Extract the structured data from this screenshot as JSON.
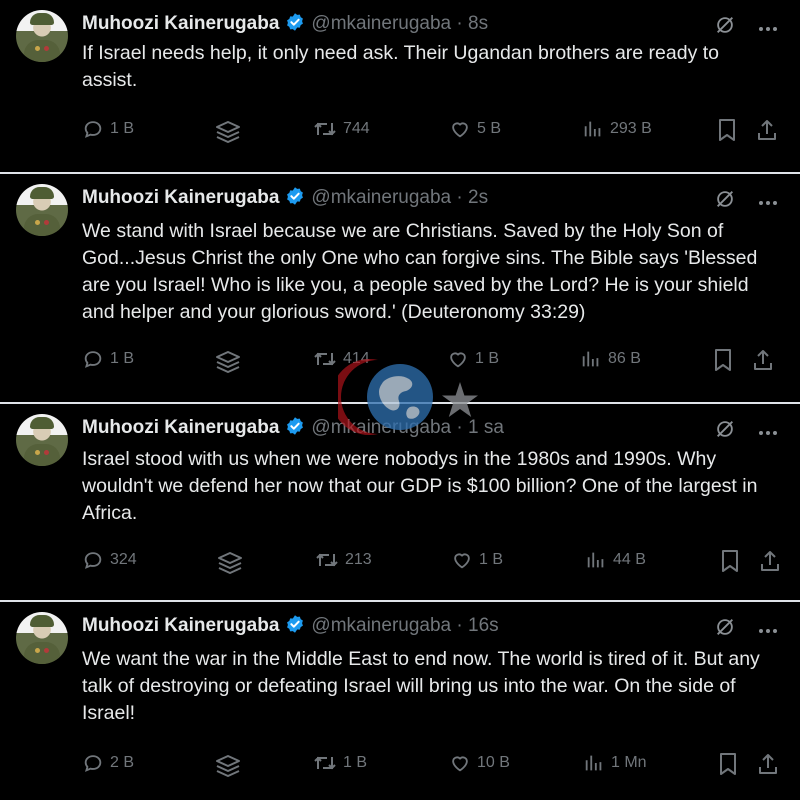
{
  "tweets": [
    {
      "name": "Muhoozi Kainerugaba",
      "handle": "@mkainerugaba",
      "dot": "·",
      "time": "8s",
      "text": "If Israel needs help, it only need ask. Their Ugandan brothers are ready to assist.",
      "replies": "1 B",
      "retweets": "744",
      "likes": "5 B",
      "views": "293 B"
    },
    {
      "name": "Muhoozi Kainerugaba",
      "handle": "@mkainerugaba",
      "dot": "·",
      "time": "2s",
      "text": "We stand with Israel because we are Christians. Saved by the Holy Son of God...Jesus Christ the only One who can forgive sins. The Bible says 'Blessed are you Israel! Who is like you, a people saved by the Lord? He is your shield and helper and your glorious sword.' (Deuteronomy 33:29)",
      "replies": "1 B",
      "retweets": "414",
      "likes": "1 B",
      "views": "86 B"
    },
    {
      "name": "Muhoozi Kainerugaba",
      "handle": "@mkainerugaba",
      "dot": "·",
      "time": "1 sa",
      "text": "Israel stood with us when we were nobodys in the 1980s and 1990s. Why wouldn't we defend her now that our GDP is $100 billion? One of the largest in Africa.",
      "replies": "324",
      "retweets": "213",
      "likes": "1 B",
      "views": "44 B"
    },
    {
      "name": "Muhoozi Kainerugaba",
      "handle": "@mkainerugaba",
      "dot": "·",
      "time": "16s",
      "text": "We want the war in the Middle East to end now. The world is tired of it. But any talk of destroying or defeating Israel will bring us into the war. On the side of Israel!",
      "replies": "2 B",
      "retweets": "1 B",
      "likes": "10 B",
      "views": "1 Mn"
    }
  ],
  "colors": {
    "background": "#000000",
    "text": "#e7e9ea",
    "muted": "#71767b",
    "verified": "#1d9bf0",
    "separator": "#dfe3e8"
  },
  "icons": [
    "verified-badge-icon",
    "grok-icon",
    "more-icon",
    "reply-icon",
    "layers-icon",
    "retweet-icon",
    "like-icon",
    "views-icon",
    "bookmark-icon",
    "share-icon"
  ]
}
